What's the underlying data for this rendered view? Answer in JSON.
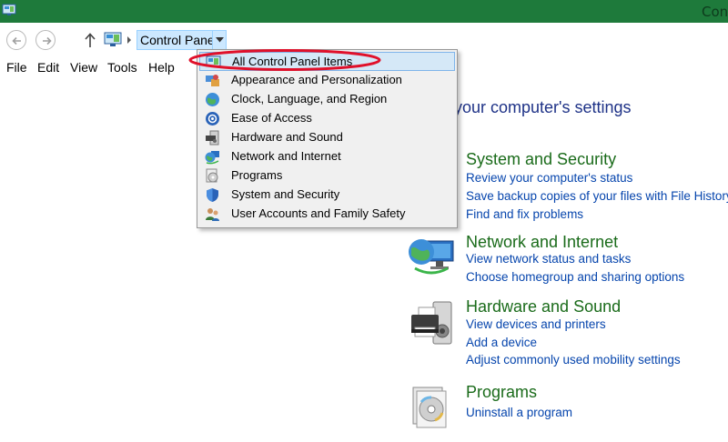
{
  "window": {
    "title": "Con"
  },
  "address": {
    "crumb": "Control Panel"
  },
  "menu": [
    "File",
    "Edit",
    "View",
    "Tools",
    "Help"
  ],
  "main": {
    "heading": "your computer's settings",
    "categories": [
      {
        "title": "System and Security",
        "links": [
          "Review your computer's status",
          "Save backup copies of your files with File History",
          "Find and fix problems"
        ]
      },
      {
        "title": "Network and Internet",
        "links": [
          "View network status and tasks",
          "Choose homegroup and sharing options"
        ]
      },
      {
        "title": "Hardware and Sound",
        "links": [
          "View devices and printers",
          "Add a device",
          "Adjust commonly used mobility settings"
        ]
      },
      {
        "title": "Programs",
        "links": [
          "Uninstall a program"
        ]
      }
    ]
  },
  "dropdown": {
    "selected_index": 0,
    "items": [
      {
        "label": "All Control Panel Items",
        "icon": "control-panel-icon"
      },
      {
        "label": "Appearance and Personalization",
        "icon": "appearance-icon"
      },
      {
        "label": "Clock, Language, and Region",
        "icon": "clock-globe-icon"
      },
      {
        "label": "Ease of Access",
        "icon": "ease-of-access-icon"
      },
      {
        "label": "Hardware and Sound",
        "icon": "hardware-sound-icon"
      },
      {
        "label": "Network and Internet",
        "icon": "network-globe-icon"
      },
      {
        "label": "Programs",
        "icon": "programs-icon"
      },
      {
        "label": "System and Security",
        "icon": "shield-icon"
      },
      {
        "label": "User Accounts and Family Safety",
        "icon": "users-icon"
      }
    ]
  },
  "colors": {
    "titlebar": "#1e7a3b",
    "category_title": "#1a6b1a",
    "link": "#0645ad",
    "annotation": "#e0102a"
  }
}
